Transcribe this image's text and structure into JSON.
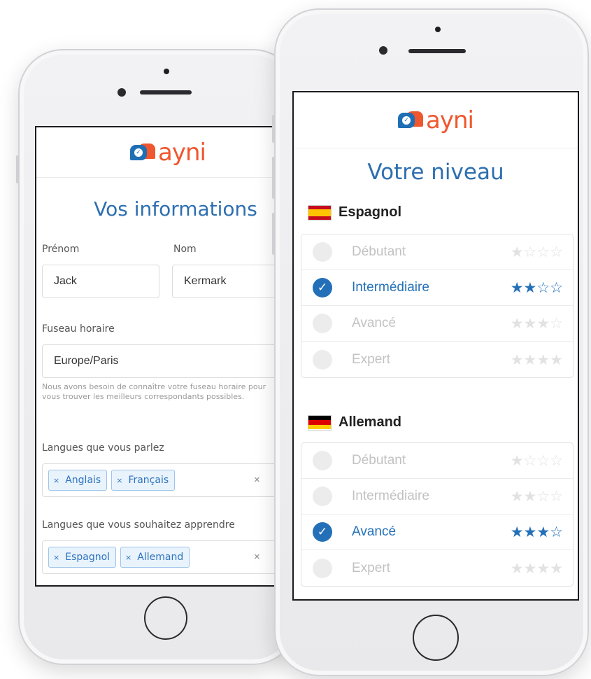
{
  "brand": {
    "name": "ayni",
    "blue": "#1f6fb5",
    "orange": "#f0572e",
    "accent": "#2470b8"
  },
  "left_screen": {
    "title": "Vos informations",
    "first_name_label": "Prénom",
    "last_name_label": "Nom",
    "first_name_value": "Jack",
    "last_name_value": "Kermark",
    "timezone_label": "Fuseau horaire",
    "timezone_value": "Europe/Paris",
    "timezone_help": "Nous avons besoin de connaître votre fuseau horaire pour vous trouver les meilleurs correspondants possibles.",
    "spoken_label": "Langues que vous parlez",
    "spoken_tags": [
      "Anglais",
      "Français"
    ],
    "learn_label": "Langues que vous souhaitez apprendre",
    "learn_tags": [
      "Espagnol",
      "Allemand"
    ],
    "tag_remove_glyph": "×",
    "clear_glyph": "×"
  },
  "right_screen": {
    "title": "Votre niveau",
    "languages": [
      {
        "name": "Espagnol",
        "flag": "spain-flag-icon",
        "levels": [
          {
            "label": "Débutant",
            "stars": "★☆☆☆",
            "selected": false
          },
          {
            "label": "Intermédiaire",
            "stars": "★★☆☆",
            "selected": true
          },
          {
            "label": "Avancé",
            "stars": "★★★☆",
            "selected": false
          },
          {
            "label": "Expert",
            "stars": "★★★★",
            "selected": false
          }
        ]
      },
      {
        "name": "Allemand",
        "flag": "germany-flag-icon",
        "levels": [
          {
            "label": "Débutant",
            "stars": "★☆☆☆",
            "selected": false
          },
          {
            "label": "Intermédiaire",
            "stars": "★★☆☆",
            "selected": false
          },
          {
            "label": "Avancé",
            "stars": "★★★☆",
            "selected": true
          },
          {
            "label": "Expert",
            "stars": "★★★★",
            "selected": false
          }
        ]
      }
    ],
    "check_glyph": "✓"
  }
}
